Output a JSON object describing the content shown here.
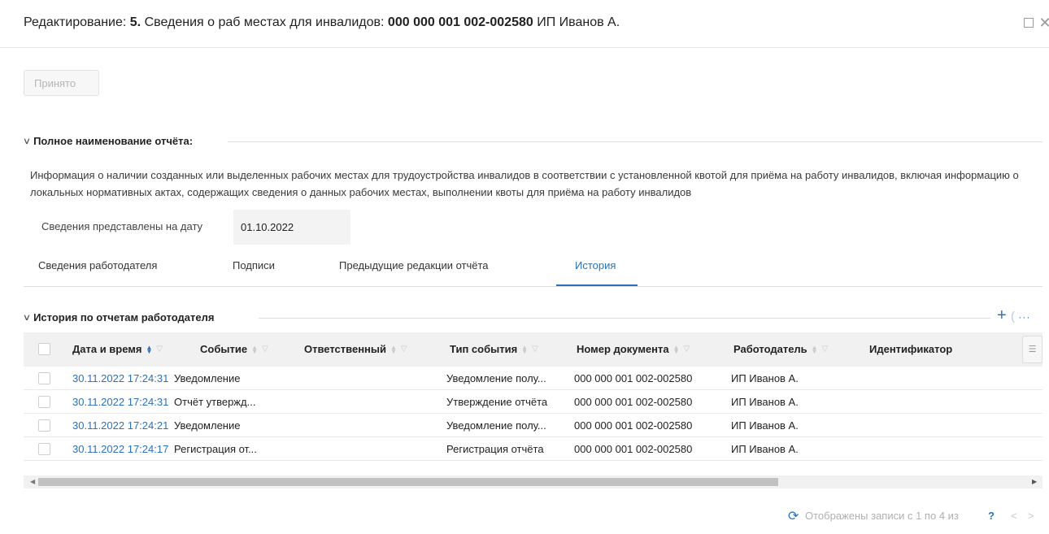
{
  "window": {
    "title_prefix": "Редактирование: ",
    "title_num": "5.",
    "title_main": " Сведения о раб местах для инвалидов: ",
    "title_doc": "000 000 001 002-002580",
    "title_suffix": " ИП Иванов А."
  },
  "toolbar": {
    "accept_label": "Принято"
  },
  "report_section": {
    "chevron": "∨",
    "title": "Полное наименование отчёта:",
    "description": "Информация о наличии созданных или выделенных рабочих местах для трудоустройства инвалидов в соответствии с установленной квотой для приёма на работу инвалидов, включая информацию о локальных нормативных актах, содержащих сведения о данных рабочих местах, выполнении квоты для приёма на работу инвалидов"
  },
  "date_field": {
    "label": "Сведения представлены на дату",
    "value": "01.10.2022"
  },
  "tabs": [
    {
      "label": "Сведения работодателя"
    },
    {
      "label": "Подписи"
    },
    {
      "label": "Предыдущие редакции отчёта"
    },
    {
      "label": "История"
    }
  ],
  "active_tab": "История",
  "history_section": {
    "chevron": "∨",
    "title": "История по отчетам работодателя",
    "add_label": "+",
    "more_label": "···"
  },
  "table": {
    "columns": [
      {
        "label": "Дата и время",
        "sorted": "desc"
      },
      {
        "label": "Событие"
      },
      {
        "label": "Ответственный"
      },
      {
        "label": "Тип события"
      },
      {
        "label": "Номер документа"
      },
      {
        "label": "Работодатель"
      },
      {
        "label": "Идентификатор"
      }
    ],
    "rows": [
      {
        "datetime": "30.11.2022 17:24:31",
        "event": "Уведомление",
        "responsible": "",
        "event_type": "Уведомление полу...",
        "doc_number": "000 000 001 002-002580",
        "employer": "ИП Иванов А.",
        "id": ""
      },
      {
        "datetime": "30.11.2022 17:24:31",
        "event": "Отчёт утвержд...",
        "responsible": "",
        "event_type": "Утверждение отчёта",
        "doc_number": "000 000 001 002-002580",
        "employer": "ИП Иванов А.",
        "id": ""
      },
      {
        "datetime": "30.11.2022 17:24:21",
        "event": "Уведомление",
        "responsible": "",
        "event_type": "Уведомление полу...",
        "doc_number": "000 000 001 002-002580",
        "employer": "ИП Иванов А.",
        "id": ""
      },
      {
        "datetime": "30.11.2022 17:24:17",
        "event": "Регистрация от...",
        "responsible": "",
        "event_type": "Регистрация отчёта",
        "doc_number": "000 000 001 002-002580",
        "employer": "ИП Иванов А.",
        "id": ""
      }
    ]
  },
  "pagination": {
    "text": "Отображены записи с 1 по 4 из",
    "total": "?",
    "prev": "<",
    "next": ">"
  },
  "colors": {
    "accent": "#2d70b8",
    "header_bg": "#f1f1f1",
    "border": "#dedede"
  }
}
